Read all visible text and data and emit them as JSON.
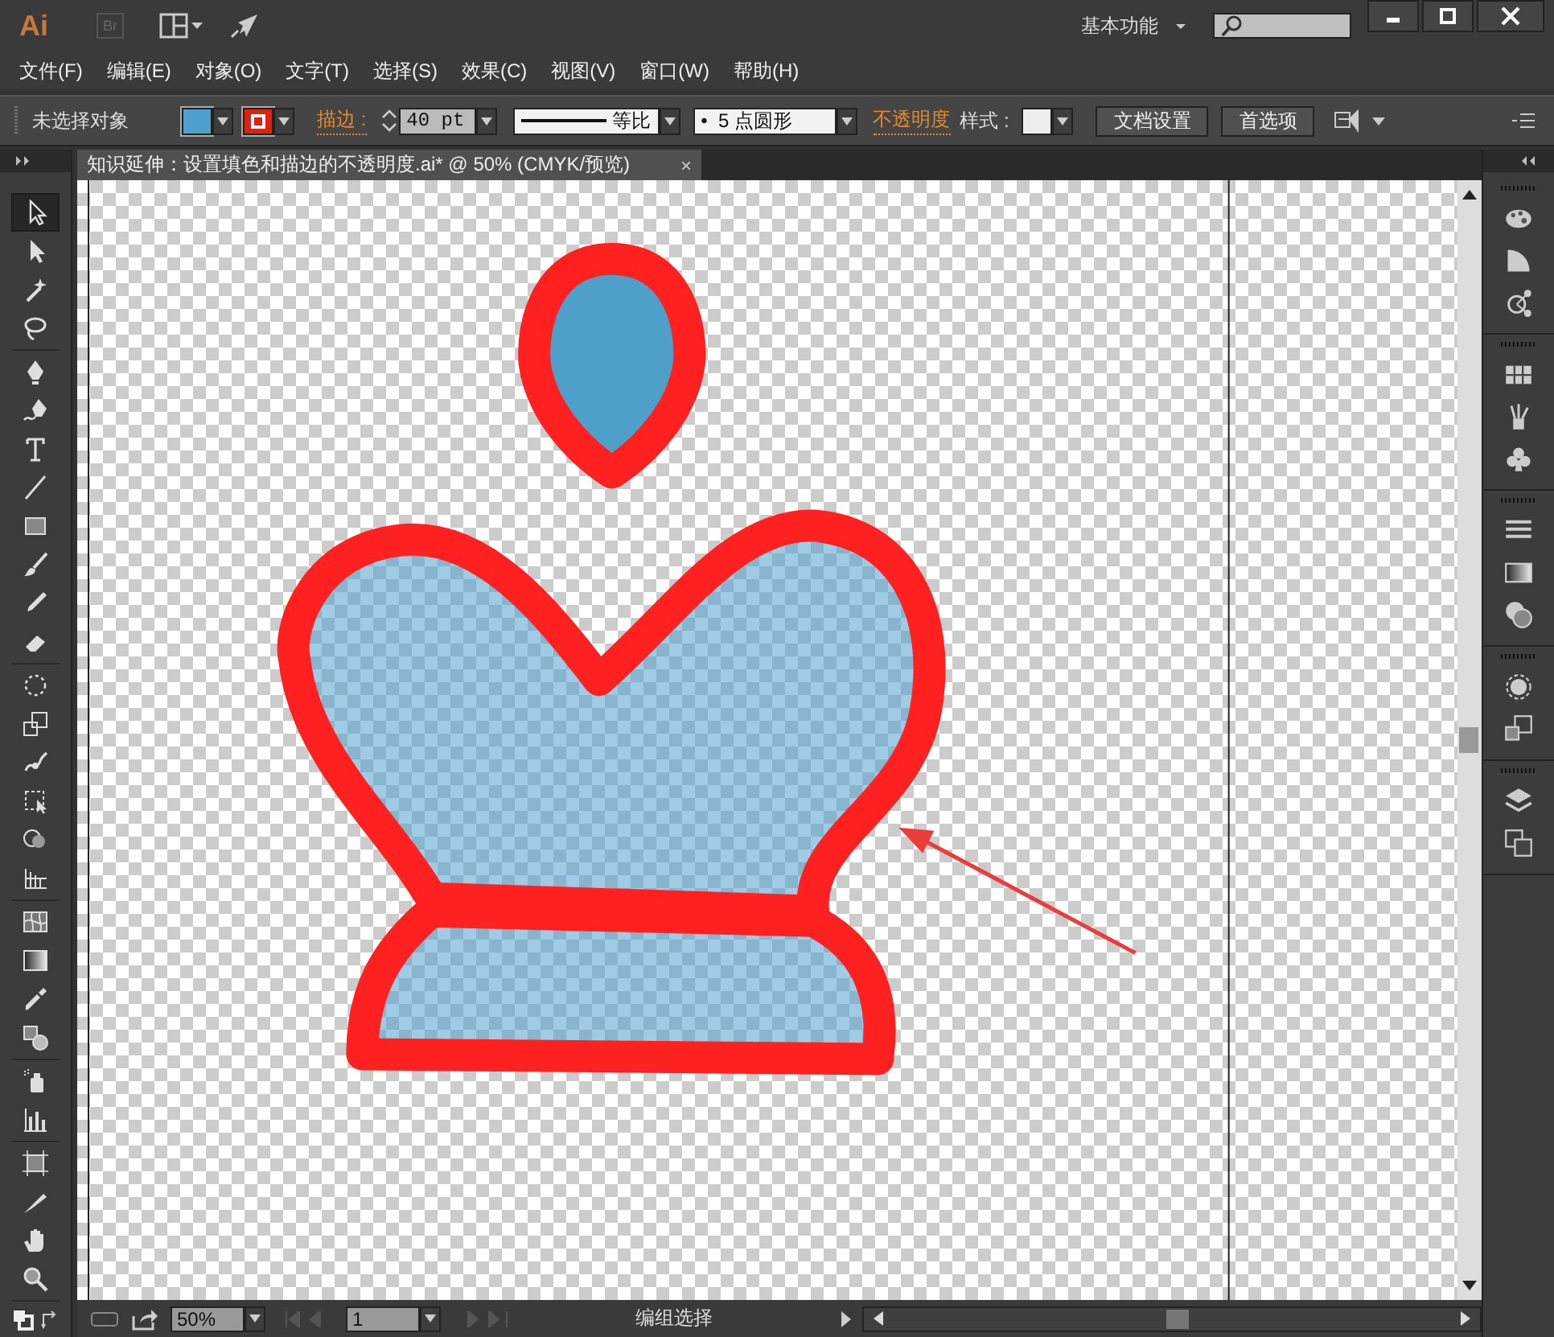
{
  "app": {
    "logo": "Ai",
    "bridge": "Br",
    "workspace": "基本功能"
  },
  "menu": [
    "文件(F)",
    "编辑(E)",
    "对象(O)",
    "文字(T)",
    "选择(S)",
    "效果(C)",
    "视图(V)",
    "窗口(W)",
    "帮助(H)"
  ],
  "control_bar": {
    "selection": "未选择对象",
    "stroke_label": "描边 :",
    "stroke_weight": "40 pt",
    "profile": "等比",
    "brush": "•  5 点圆形",
    "opacity_label": "不透明度",
    "style_label": "样式 :",
    "buttons": [
      "文档设置",
      "首选项"
    ]
  },
  "document_tab": {
    "title": "知识延伸：设置填色和描边的不透明度.ai* @ 50% (CMYK/预览)",
    "close": "×"
  },
  "tool_groups": [
    {
      "tools": [
        {
          "kind": "selection",
          "selected": true
        },
        {
          "kind": "direct",
          "selected": false
        },
        {
          "kind": "wand",
          "selected": false
        },
        {
          "kind": "lasso",
          "selected": false
        }
      ]
    },
    {
      "tools": [
        {
          "kind": "pen",
          "selected": false
        },
        {
          "kind": "curvature",
          "selected": false
        },
        {
          "kind": "type",
          "selected": false
        },
        {
          "kind": "line",
          "selected": false
        },
        {
          "kind": "rect",
          "selected": false
        },
        {
          "kind": "brush",
          "selected": false
        },
        {
          "kind": "pencil",
          "selected": false
        },
        {
          "kind": "eraser",
          "selected": false
        }
      ]
    },
    {
      "tools": [
        {
          "kind": "rotate",
          "selected": false
        },
        {
          "kind": "scale",
          "selected": false
        },
        {
          "kind": "warp",
          "selected": false
        },
        {
          "kind": "free",
          "selected": false
        },
        {
          "kind": "builder",
          "selected": false
        },
        {
          "kind": "graph",
          "selected": false
        }
      ]
    },
    {
      "tools": [
        {
          "kind": "mesh",
          "selected": false
        },
        {
          "kind": "gradient",
          "selected": false
        },
        {
          "kind": "eyedropper",
          "selected": false
        },
        {
          "kind": "blend",
          "selected": false
        }
      ]
    },
    {
      "tools": [
        {
          "kind": "spray",
          "selected": false
        },
        {
          "kind": "chart",
          "selected": false
        }
      ]
    },
    {
      "tools": [
        {
          "kind": "artboard",
          "selected": false
        },
        {
          "kind": "slice",
          "selected": false
        },
        {
          "kind": "hand",
          "selected": false
        },
        {
          "kind": "zoom",
          "selected": false
        }
      ]
    }
  ],
  "status_bar": {
    "zoom": "50%",
    "artboard": "1",
    "info": "编组选择"
  }
}
